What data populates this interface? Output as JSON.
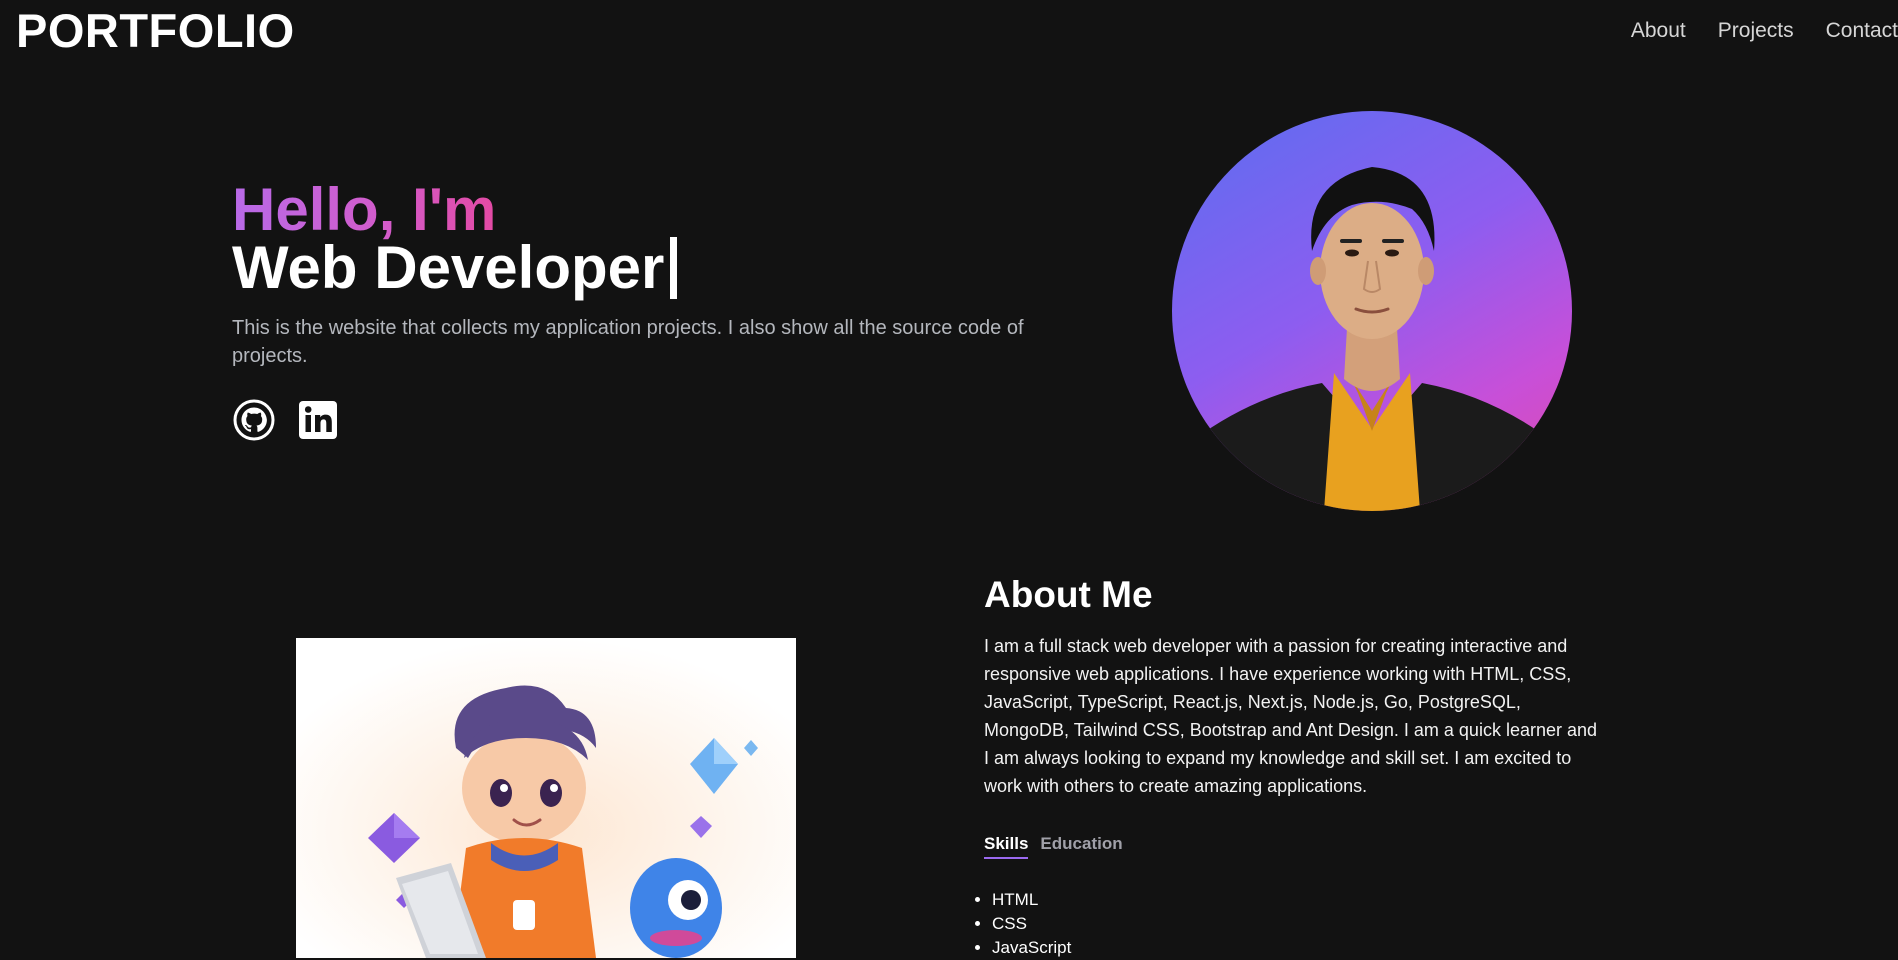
{
  "header": {
    "logo": "PORTFOLIO",
    "nav": [
      {
        "label": "About"
      },
      {
        "label": "Projects"
      },
      {
        "label": "Contact"
      }
    ]
  },
  "hero": {
    "greeting": "Hello, I'm",
    "role": "Web Developer",
    "intro": "This is the website that collects my application projects. I also show all the source code of projects.",
    "socials": [
      {
        "icon": "github-icon"
      },
      {
        "icon": "linkedin-icon"
      }
    ]
  },
  "about": {
    "title": "About Me",
    "text": "I am a full stack web developer with a passion for creating interactive and responsive web applications. I have experience working with HTML, CSS, JavaScript, TypeScript, React.js, Next.js, Node.js, Go, PostgreSQL, MongoDB, Tailwind CSS, Bootstrap and Ant Design. I am a quick learner and I am always looking to expand my knowledge and skill set. I am excited to work with others to create amazing applications.",
    "tabs": [
      {
        "label": "Skills",
        "active": true
      },
      {
        "label": "Education",
        "active": false
      }
    ],
    "skills": [
      "HTML",
      "CSS",
      "JavaScript"
    ]
  },
  "colors": {
    "background": "#121212",
    "gradient_start": "#b86ae8",
    "gradient_end": "#e34aa4",
    "avatar_gradient_start": "#5b6ef0",
    "avatar_gradient_end": "#e04aa8",
    "tab_underline": "#9b6af0"
  }
}
